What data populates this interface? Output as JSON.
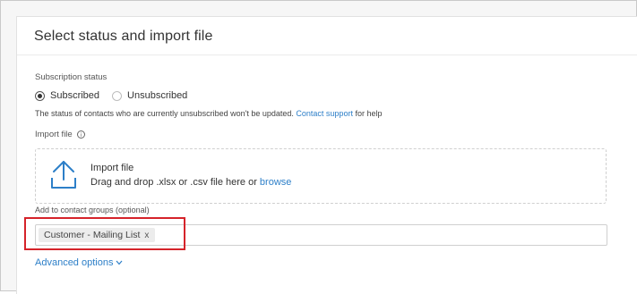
{
  "card": {
    "title": "Select status and import file"
  },
  "subscription": {
    "label": "Subscription status",
    "options": [
      {
        "label": "Subscribed",
        "checked": true
      },
      {
        "label": "Unsubscribed",
        "checked": false
      }
    ],
    "help_prefix": "The status of contacts who are currently unsubscribed won't be updated.",
    "help_link": "Contact support",
    "help_suffix": "for help"
  },
  "import": {
    "label": "Import file",
    "info_icon": "info-icon",
    "dropzone_title": "Import file",
    "dropzone_text": "Drag and drop .xlsx or .csv file here or",
    "browse_link": "browse",
    "upload_icon": "upload-icon"
  },
  "groups": {
    "label": "Add to contact groups (optional)",
    "tags": [
      {
        "label": "Customer - Mailing List",
        "remove": "x"
      }
    ]
  },
  "advanced": {
    "label": "Advanced options",
    "icon": "chevron-down-icon"
  },
  "colors": {
    "link": "#2d7fc8",
    "highlight": "#d5232a"
  }
}
